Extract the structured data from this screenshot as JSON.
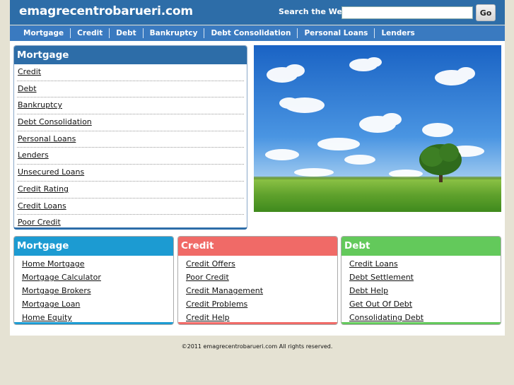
{
  "site": {
    "title": "emagrecentrobarueri.com"
  },
  "search": {
    "label": "Search the Web:",
    "value": "",
    "button": "Go"
  },
  "nav": [
    "Mortgage",
    "Credit",
    "Debt",
    "Bankruptcy",
    "Debt Consolidation",
    "Personal Loans",
    "Lenders"
  ],
  "sidebar": {
    "title": "Mortgage",
    "items": [
      "Credit",
      "Debt",
      "Bankruptcy",
      "Debt Consolidation",
      "Personal Loans",
      "Lenders",
      "Unsecured Loans",
      "Credit Rating",
      "Credit Loans",
      "Poor Credit"
    ]
  },
  "cards": [
    {
      "title": "Mortgage",
      "color": "#1c9bd2",
      "items": [
        "Home Mortgage",
        "Mortgage Calculator",
        "Mortgage Brokers",
        "Mortgage Loan",
        "Home Equity"
      ]
    },
    {
      "title": "Credit",
      "color": "#f06a67",
      "items": [
        "Credit Offers",
        "Poor Credit",
        "Credit Management",
        "Credit Problems",
        "Credit Help"
      ]
    },
    {
      "title": "Debt",
      "color": "#63c95b",
      "items": [
        "Credit Loans",
        "Debt Settlement",
        "Debt Help",
        "Get Out Of Debt",
        "Consolidating Debt"
      ]
    }
  ],
  "footer": "©2011 emagrecentrobarueri.com All rights reserved.",
  "colors": {
    "header": "#2d6da8",
    "navbar": "#3a7ac0",
    "background": "#e5e2d3"
  }
}
